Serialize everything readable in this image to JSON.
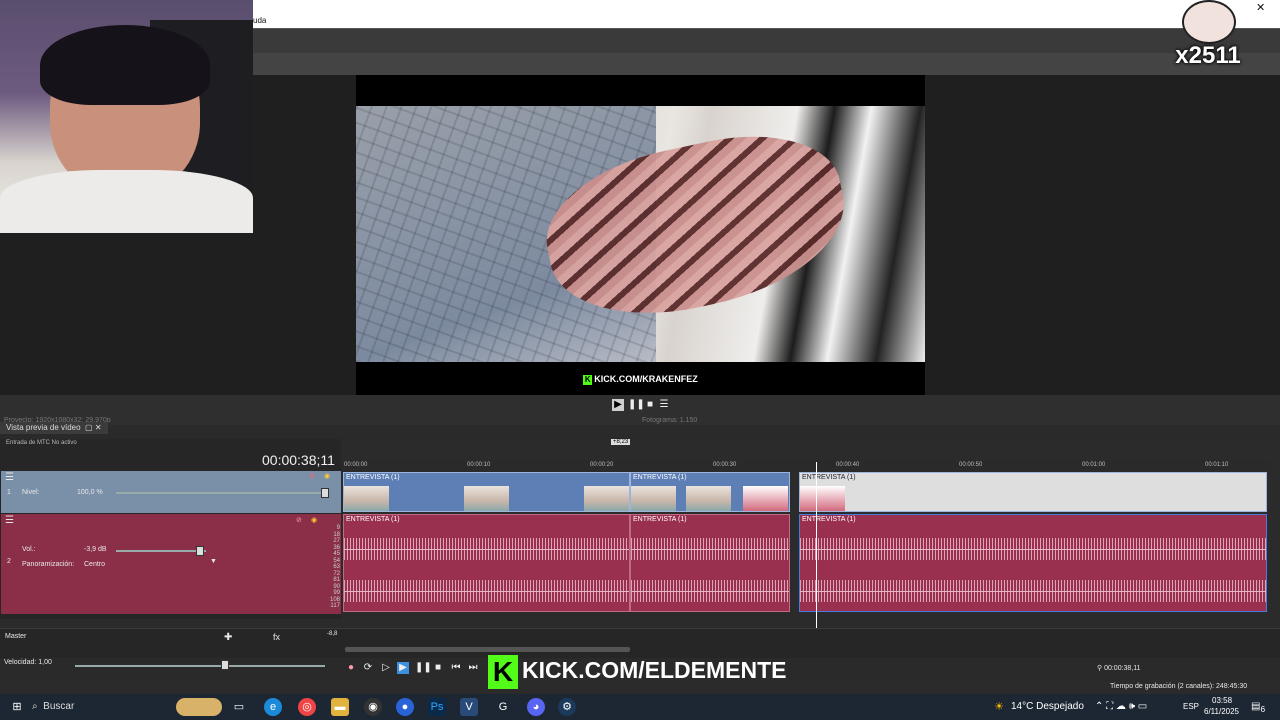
{
  "window": {
    "title_fragment": "uda",
    "close": "✕"
  },
  "video_preview": {
    "watermark": "KICK.COM/KRAKENFEZ",
    "tab_label": "Vista previa de vídeo",
    "faded_left": "Proyecto:    1920x1080x32; 29,970p",
    "faded_right": "Fotograma:    1.150"
  },
  "badge": {
    "label": "x2511"
  },
  "timeline": {
    "mtc_label": "Entrada de MTC No activo",
    "timecode": "00:00:38;11",
    "ruler": [
      "00:00:00",
      "00:00:10",
      "00:00:20",
      "00:00:30",
      "00:00:40",
      "00:00:50",
      "00:01:00",
      "00:01:10"
    ],
    "region_marker": "+8;23",
    "video_track": {
      "number": "1",
      "level_label": "Nivel:",
      "level_value": "100,0 %"
    },
    "audio_track": {
      "number": "2",
      "vol_label": "Vol.:",
      "vol_value": "-3,9 dB",
      "pan_label": "Panoramización:",
      "pan_value": "Centro"
    },
    "db_scale": [
      "9",
      "18",
      "27",
      "36",
      "45",
      "54",
      "63",
      "72",
      "81",
      "90",
      "99",
      "108",
      "117"
    ],
    "clip_name": "ENTREVISTA (1)",
    "master_label": "Master",
    "master_value": "-8,8",
    "speed_label": "Velocidad: 1,00",
    "cursor_time": "00:00:38,11",
    "status": "Tiempo de grabación (2 canales): 248:45:30"
  },
  "overlay": {
    "kick_text": "KICK.COM/ELDEMENTE",
    "kick_letter": "K"
  },
  "taskbar": {
    "search_label": "Buscar",
    "weather": "14°C  Despejado",
    "lang": "ESP",
    "time": "03:58",
    "date": "6/11/2025",
    "notif_count": "6"
  },
  "colors": {
    "kick_green": "#53fc18",
    "video_track": "#7a8fa8",
    "audio_track": "#8b2f48"
  }
}
